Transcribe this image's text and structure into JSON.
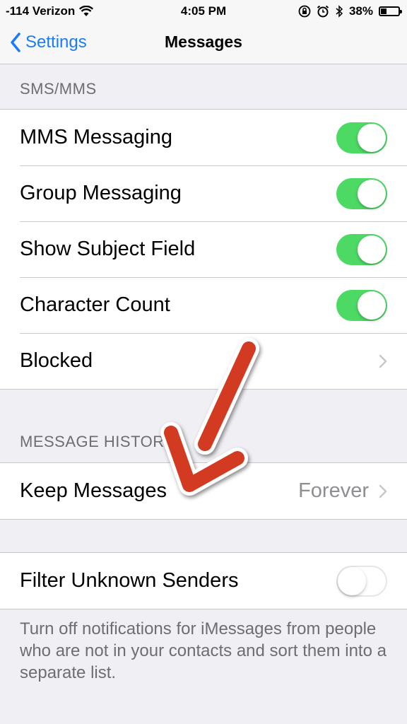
{
  "status_bar": {
    "carrier": "-114 Verizon",
    "time": "4:05 PM",
    "battery": "38%",
    "battery_level": 0.38
  },
  "nav": {
    "back_label": "Settings",
    "title": "Messages"
  },
  "sms_section": {
    "header": "SMS/MMS",
    "items": [
      {
        "label": "MMS Messaging",
        "toggle": true
      },
      {
        "label": "Group Messaging",
        "toggle": true
      },
      {
        "label": "Show Subject Field",
        "toggle": true
      },
      {
        "label": "Character Count",
        "toggle": true
      },
      {
        "label": "Blocked"
      }
    ]
  },
  "history_section": {
    "header": "MESSAGE HISTORY",
    "keep_label": "Keep Messages",
    "keep_value": "Forever"
  },
  "filter_section": {
    "label": "Filter Unknown Senders",
    "toggle": false,
    "note": "Turn off notifications for iMessages from people who are not in your contacts and sort them into a separate list."
  },
  "colors": {
    "accent": "#1a7cf6",
    "toggle_on": "#4cd964",
    "arrow": "#d23a22"
  }
}
